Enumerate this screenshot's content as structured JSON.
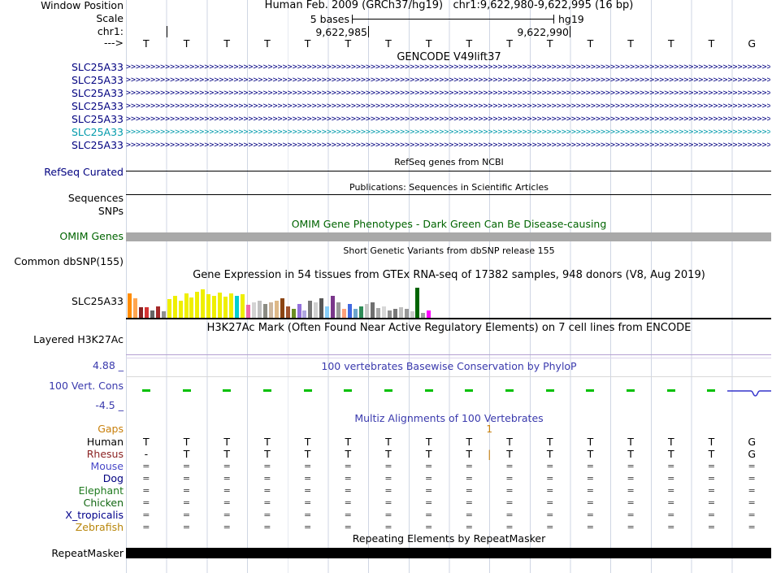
{
  "colors": {
    "navy": "#000080",
    "teal": "#009aab",
    "omim_green": "#006400",
    "title_blue": "#3a3aad",
    "orange": "#c87f0a",
    "grid": "#cfd6e3",
    "cons_green": "#00c000",
    "h3k27ac_line": "#b4a0d2",
    "omim_bar": "#a9a9a9",
    "phylop_blue": "#3333cc",
    "black": "#000000"
  },
  "header": {
    "window_position_label": "Window Position",
    "position_text": "Human Feb. 2009 (GRCh37/hg19)   chr1:9,622,980-9,622,995 (16 bp)",
    "scale_label": "Scale",
    "scale_value": "5 bases",
    "assembly": "hg19",
    "chrom_label": "chr1:",
    "coord_major_1": "9,622,985",
    "coord_major_2": "9,622,990",
    "strand_label": "--->"
  },
  "sequence": {
    "bases": [
      "T",
      "T",
      "T",
      "T",
      "T",
      "T",
      "T",
      "T",
      "T",
      "T",
      "T",
      "T",
      "T",
      "T",
      "T",
      "G"
    ]
  },
  "tracks": {
    "gencode": {
      "title": "GENCODE V49lift37",
      "genes": [
        {
          "label": "SLC25A33",
          "color": "#000080"
        },
        {
          "label": "SLC25A33",
          "color": "#000080"
        },
        {
          "label": "SLC25A33",
          "color": "#000080"
        },
        {
          "label": "SLC25A33",
          "color": "#000080"
        },
        {
          "label": "SLC25A33",
          "color": "#000080"
        },
        {
          "label": "SLC25A33",
          "color": "#009aab"
        },
        {
          "label": "SLC25A33",
          "color": "#000080"
        }
      ]
    },
    "refseq": {
      "center_label": "RefSeq genes from NCBI",
      "label": "RefSeq Curated"
    },
    "publications": {
      "center_label": "Publications: Sequences in Scientific Articles",
      "label": "Sequences"
    },
    "snps": {
      "label": "SNPs"
    },
    "omim": {
      "center_label": "OMIM Gene Phenotypes - Dark Green Can Be Disease-causing",
      "label": "OMIM Genes"
    },
    "dbsnp": {
      "center_label": "Short Genetic Variants from dbSNP release 155",
      "label": "Common dbSNP(155)"
    },
    "gtex": {
      "center_label": "Gene Expression in 54 tissues from GTEx RNA-seq of 17382 samples, 948 donors (V8, Aug 2019)",
      "label": "SLC25A33"
    },
    "h3k27ac": {
      "center_label": "H3K27Ac Mark (Often Found Near Active Regulatory Elements) on 7 cell lines from ENCODE",
      "label": "Layered H3K27Ac"
    },
    "phylop": {
      "center_label": "100 vertebrates Basewise Conservation by PhyloP",
      "label": "100 Vert. Cons",
      "max_label": "4.88 _",
      "min_label": "-4.5 _",
      "tick_columns": [
        0,
        1,
        2,
        3,
        4,
        5,
        6,
        7,
        8,
        9,
        10,
        11,
        12,
        13,
        14
      ]
    },
    "multiz": {
      "center_label": "Multiz Alignments of 100 Vertebrates",
      "gaps_label": "Gaps",
      "gap_count": "1",
      "species": [
        {
          "label": "Human",
          "label_color": "#000000",
          "cells": [
            "T",
            "T",
            "T",
            "T",
            "T",
            "T",
            "T",
            "T",
            "T",
            "T",
            "T",
            "T",
            "T",
            "T",
            "T",
            "G"
          ]
        },
        {
          "label": "Rhesus",
          "label_color": "#8b2323",
          "insertion_boundary": 9,
          "cells": [
            "-",
            "T",
            "T",
            "T",
            "T",
            "T",
            "T",
            "T",
            "T",
            "T",
            "T",
            "T",
            "T",
            "T",
            "T",
            "G"
          ]
        },
        {
          "label": "Mouse",
          "label_color": "#4848c8",
          "cells": [
            "=",
            "=",
            "=",
            "=",
            "=",
            "=",
            "=",
            "=",
            "=",
            "=",
            "=",
            "=",
            "=",
            "=",
            "=",
            "="
          ]
        },
        {
          "label": "Dog",
          "label_color": "#000080",
          "cells": [
            "=",
            "=",
            "=",
            "=",
            "=",
            "=",
            "=",
            "=",
            "=",
            "=",
            "=",
            "=",
            "=",
            "=",
            "=",
            "="
          ]
        },
        {
          "label": "Elephant",
          "label_color": "#1f7a1f",
          "cells": [
            "=",
            "=",
            "=",
            "=",
            "=",
            "=",
            "=",
            "=",
            "=",
            "=",
            "=",
            "=",
            "=",
            "=",
            "=",
            "="
          ]
        },
        {
          "label": "Chicken",
          "label_color": "#116611",
          "cells": [
            "=",
            "=",
            "=",
            "=",
            "=",
            "=",
            "=",
            "=",
            "=",
            "=",
            "=",
            "=",
            "=",
            "=",
            "=",
            "="
          ]
        },
        {
          "label": "X_tropicalis",
          "label_color": "#00008b",
          "cells": [
            "=",
            "=",
            "=",
            "=",
            "=",
            "=",
            "=",
            "=",
            "=",
            "=",
            "=",
            "=",
            "=",
            "=",
            "=",
            "="
          ]
        },
        {
          "label": "Zebrafish",
          "label_color": "#b8860b",
          "cells": [
            "=",
            "=",
            "=",
            "=",
            "=",
            "=",
            "=",
            "=",
            "=",
            "=",
            "=",
            "=",
            "=",
            "=",
            "=",
            "="
          ]
        }
      ]
    },
    "repeatmasker": {
      "center_label": "Repeating Elements by RepeatMasker",
      "label": "RepeatMasker"
    }
  },
  "chart_data": {
    "type": "bar",
    "title": "Gene Expression in 54 tissues from GTEx RNA-seq of 17382 samples, 948 donors (V8, Aug 2019)",
    "gene": "SLC25A33",
    "note": "54 GTEx tissue bars colored by tissue convention; tissue names not visible in screenshot; values are approximate relative expression heights in pixels.",
    "ylim": [
      0,
      39
    ],
    "values": [
      30,
      24,
      13,
      13,
      9,
      14,
      8,
      23,
      27,
      21,
      30,
      25,
      32,
      35,
      29,
      27,
      31,
      26,
      30,
      27,
      29,
      16,
      19,
      21,
      17,
      19,
      21,
      24,
      14,
      11,
      17,
      9,
      21,
      19,
      24,
      14,
      27,
      19,
      11,
      17,
      11,
      14,
      17,
      19,
      12,
      14,
      9,
      11,
      13,
      11,
      8,
      37,
      6,
      9
    ],
    "colors": [
      "#ff8c00",
      "#ffa54f",
      "#8b2222",
      "#d43333",
      "#666666",
      "#a52a2a",
      "#909090",
      "#efef00",
      "#efef00",
      "#efef00",
      "#efef00",
      "#efef00",
      "#efef00",
      "#efef00",
      "#efef00",
      "#efef00",
      "#efef00",
      "#efef00",
      "#efef00",
      "#00ced1",
      "#efef00",
      "#ee6aa7",
      "#d3d3d3",
      "#c0c0c0",
      "#8b8b83",
      "#cdb79e",
      "#deb887",
      "#8b4513",
      "#a0522d",
      "#6b8e23",
      "#9370db",
      "#b0a6e0",
      "#787878",
      "#d0d0d0",
      "#585858",
      "#87cefa",
      "#7a378b",
      "#989898",
      "#ffa07a",
      "#4169e1",
      "#6ca6cd",
      "#2e8b57",
      "#c8c8c8",
      "#707070",
      "#a8a8a8",
      "#d8d8d8",
      "#909090",
      "#787878",
      "#bfbfbf",
      "#989898",
      "#cccccc",
      "#006400",
      "#a0a0a0",
      "#ff00ff"
    ]
  }
}
